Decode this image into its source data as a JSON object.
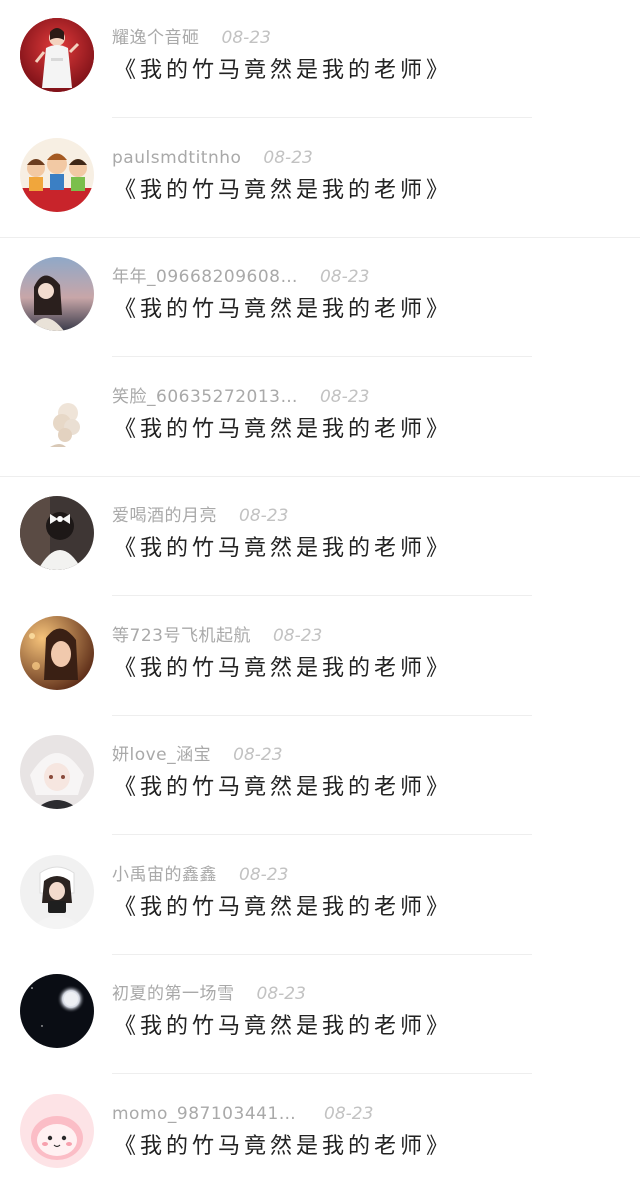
{
  "comments": [
    {
      "name": "耀逸个音砸",
      "date": "08-23",
      "text": "《我的竹马竟然是我的老师》",
      "avatar": "avatar-idol-white-dress"
    },
    {
      "name": "paulsmdtitnho",
      "date": "08-23",
      "text": "《我的竹马竟然是我的老师》",
      "avatar": "avatar-cartoon-children"
    },
    {
      "name": "年年_09668209608…",
      "date": "08-23",
      "text": "《我的竹马竟然是我的老师》",
      "avatar": "avatar-girl-by-sea"
    },
    {
      "name": "笑脸_60635272013…",
      "date": "08-23",
      "text": "《我的竹马竟然是我的老师》",
      "avatar": "avatar-curly-hair-light"
    },
    {
      "name": "爱喝酒的月亮",
      "date": "08-23",
      "text": "《我的竹马竟然是我的老师》",
      "avatar": "avatar-girl-back-bow"
    },
    {
      "name": "等723号飞机起航",
      "date": "08-23",
      "text": "《我的竹马竟然是我的老师》",
      "avatar": "avatar-girl-warm-light"
    },
    {
      "name": "妍love_涵宝",
      "date": "08-23",
      "text": "《我的竹马竟然是我的老师》",
      "avatar": "avatar-anime-white-hair"
    },
    {
      "name": "小禹宙的鑫鑫",
      "date": "08-23",
      "text": "《我的竹马竟然是我的老师》",
      "avatar": "avatar-girl-with-camera"
    },
    {
      "name": "初夏的第一场雪",
      "date": "08-23",
      "text": "《我的竹马竟然是我的老师》",
      "avatar": "avatar-moon-night"
    },
    {
      "name": "momo_98710344150…",
      "date": "08-23",
      "text": "《我的竹马竟然是我的老师》",
      "avatar": "avatar-pink-cartoon"
    }
  ],
  "colors": {
    "name": "#a9a9a9",
    "date": "#c2c2c2",
    "text": "#222222",
    "divider": "#eeeeee"
  }
}
